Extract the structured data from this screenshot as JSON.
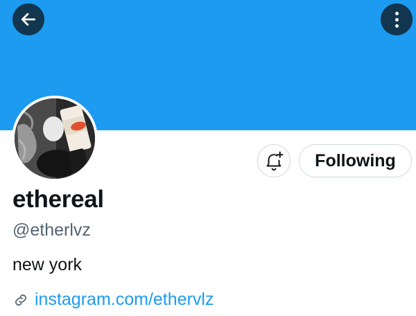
{
  "colors": {
    "banner": "#1d9bf0",
    "link": "#1d9bf0",
    "text_primary": "#0f1419",
    "text_secondary": "#536471",
    "button_border": "#cfd9de"
  },
  "header": {
    "back_icon": "arrow-left-icon",
    "more_icon": "more-vertical-icon"
  },
  "profile": {
    "display_name": "ethereal",
    "handle": "@etherlvz",
    "bio": "new york",
    "link_icon": "link-icon",
    "link_text": "instagram.com/ethervlz"
  },
  "actions": {
    "notify_icon": "bell-plus-icon",
    "following_label": "Following"
  }
}
